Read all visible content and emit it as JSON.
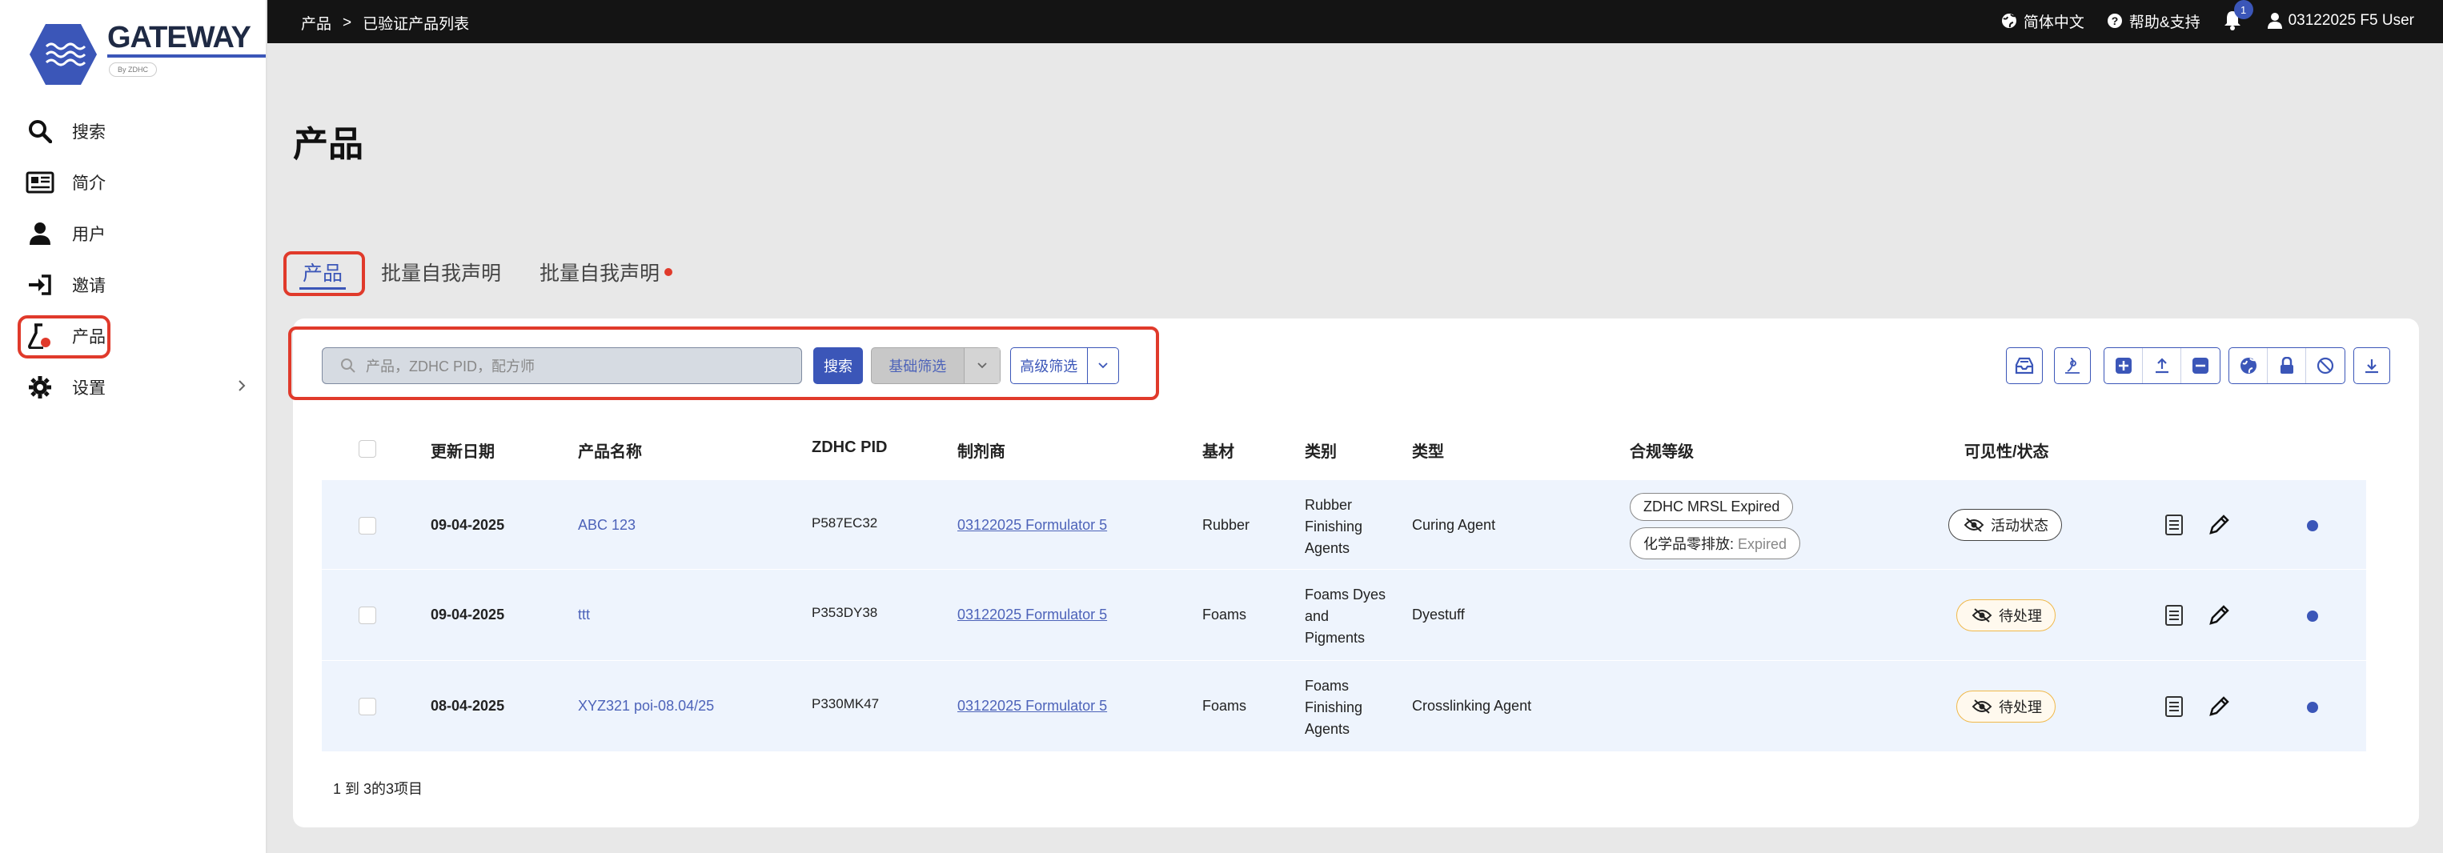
{
  "brand": {
    "logo_text": "GATEWAY",
    "logo_sub": "By ZDHC"
  },
  "sidebar": {
    "items": [
      {
        "label": "搜索",
        "icon": "search-icon"
      },
      {
        "label": "简介",
        "icon": "newspaper-icon"
      },
      {
        "label": "用户",
        "icon": "user-icon"
      },
      {
        "label": "邀请",
        "icon": "sign-in-icon"
      },
      {
        "label": "产品",
        "icon": "flask-icon",
        "active": true
      },
      {
        "label": "设置",
        "icon": "gear-icon",
        "has_children": true
      }
    ]
  },
  "topbar": {
    "breadcrumb": [
      "产品",
      "已验证产品列表"
    ],
    "breadcrumb_sep": ">",
    "language": "简体中文",
    "help": "帮助&支持",
    "notification_count": "1",
    "user": "03122025 F5 User"
  },
  "page": {
    "title": "产品",
    "tabs": [
      "产品",
      "批量自我声明",
      "批量自我声明"
    ],
    "active_tab": 0
  },
  "filters": {
    "search_placeholder": "产品，ZDHC PID，配方师",
    "search_button": "搜索",
    "basic_filter": "基础筛选",
    "advanced_filter": "高级筛选"
  },
  "table": {
    "headers": [
      "更新日期",
      "产品名称",
      "ZDHC PID",
      "制剂商",
      "基材",
      "类别",
      "类型",
      "合规等级",
      "可见性/状态"
    ],
    "rows": [
      {
        "date": "09-04-2025",
        "name": "ABC 123",
        "pid": "P587EC32",
        "formulator": "03122025 Formulator 5",
        "substrate": "Rubber",
        "category": [
          "Rubber",
          "Finishing",
          "Agents"
        ],
        "type": "Curing Agent",
        "compliance": [
          {
            "label": "ZDHC MRSL Expired",
            "suffix": ""
          },
          {
            "label": "化学品零排放:",
            "suffix": " Expired"
          }
        ],
        "status": "活动状态",
        "status_kind": "active"
      },
      {
        "date": "09-04-2025",
        "name": "ttt",
        "pid": "P353DY38",
        "formulator": "03122025 Formulator 5",
        "substrate": "Foams",
        "category": [
          "Foams Dyes",
          "and",
          "Pigments"
        ],
        "type": "Dyestuff",
        "compliance": [],
        "status": "待处理",
        "status_kind": "pending"
      },
      {
        "date": "08-04-2025",
        "name": "XYZ321 poi-08.04/25",
        "pid": "P330MK47",
        "formulator": "03122025 Formulator 5",
        "substrate": "Foams",
        "category": [
          "Foams",
          "Finishing",
          "Agents"
        ],
        "type": "Crosslinking Agent",
        "compliance": [],
        "status": "待处理",
        "status_kind": "pending"
      }
    ],
    "footer": "1 到 3的3项目"
  },
  "colors": {
    "accent": "#3b56b8",
    "highlight_ring": "#e03a2b",
    "row_bg": "#eef4fd",
    "pending_border": "#f0b84a"
  }
}
